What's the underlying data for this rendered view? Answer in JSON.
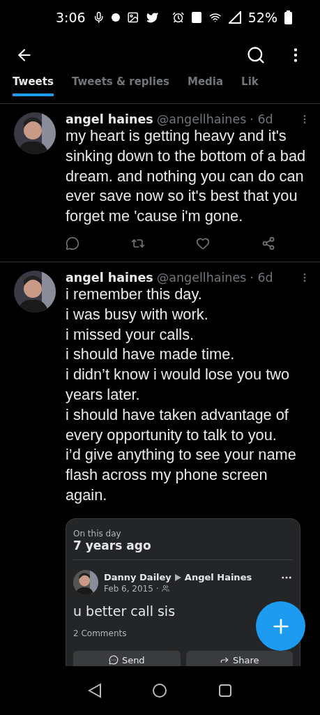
{
  "status_bar": {
    "time": "3:06",
    "battery": "52%"
  },
  "tabs": [
    {
      "label": "Tweets",
      "selected": true
    },
    {
      "label": "Tweets & replies",
      "selected": false
    },
    {
      "label": "Media",
      "selected": false
    },
    {
      "label": "Lik",
      "selected": false
    }
  ],
  "tweets": [
    {
      "name": "angel haines",
      "handle": "@angellhaines",
      "time": "· 6d",
      "lines": [
        "my heart is getting heavy and it's sinking down to the bottom of a bad dream. and nothing you can do can ever save now so it's best that you forget me 'cause i'm gone."
      ],
      "actions": true
    },
    {
      "name": "angel haines",
      "handle": "@angellhaines",
      "time": "· 6d",
      "lines": [
        "i remember this day.",
        "i was busy with work.",
        "i missed your calls.",
        "i should have made time.",
        "i didn’t know i would lose you two years later.",
        "i should have taken advantage of every opportunity to talk to you.",
        "i’d give anything to see your name flash across my phone screen again."
      ],
      "actions": false,
      "memory": {
        "label": "On this day",
        "title": "7 years ago",
        "author": "Danny Dailey",
        "recipient": "Angel Haines",
        "date": "Feb 6, 2015 ·",
        "text": "u better call sis",
        "comments": "2 Comments",
        "buttons": [
          "Send",
          "Share"
        ]
      }
    }
  ]
}
